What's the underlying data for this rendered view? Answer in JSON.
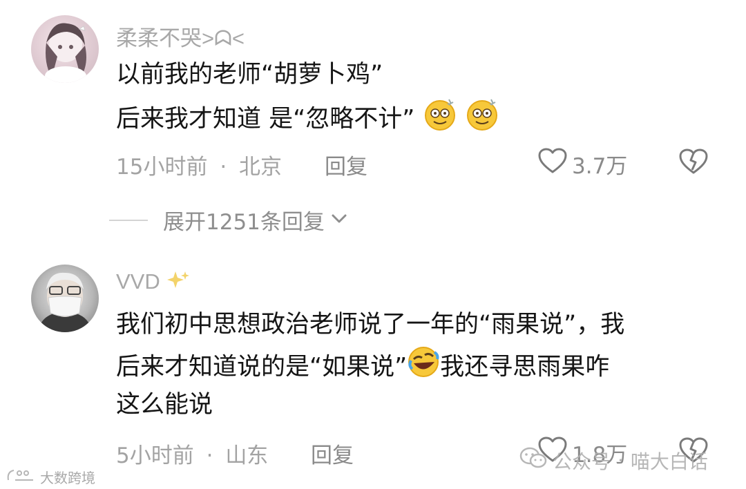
{
  "comments": [
    {
      "username": "柔柔不哭>ᗣ<",
      "lines": [
        "以前我的老师“胡萝卜鸡”",
        "后来我才知道 是“忽略不计”"
      ],
      "time": "15小时前",
      "location": "北京",
      "reply_label": "回复",
      "likes": "3.7万",
      "expand_label": "展开1251条回复"
    },
    {
      "username": "VVD",
      "lines": [
        "我们初中思想政治老师说了一年的“雨果说”，我",
        "后来才知道说的是“如果说”",
        "我还寻思雨果咋",
        "这么能说"
      ],
      "time": "5小时前",
      "location": "山东",
      "reply_label": "回复",
      "likes": "1.8万"
    }
  ],
  "separator": "·",
  "watermarks": {
    "left": "大数跨境",
    "right_prefix": "公众号",
    "right_name": "喵大白话"
  },
  "icons": [
    "heart-outline-icon",
    "broken-heart-icon",
    "chevron-down-icon",
    "dizzy-face-emoji",
    "rofl-emoji",
    "sparkles-emoji",
    "wechat-icon"
  ]
}
